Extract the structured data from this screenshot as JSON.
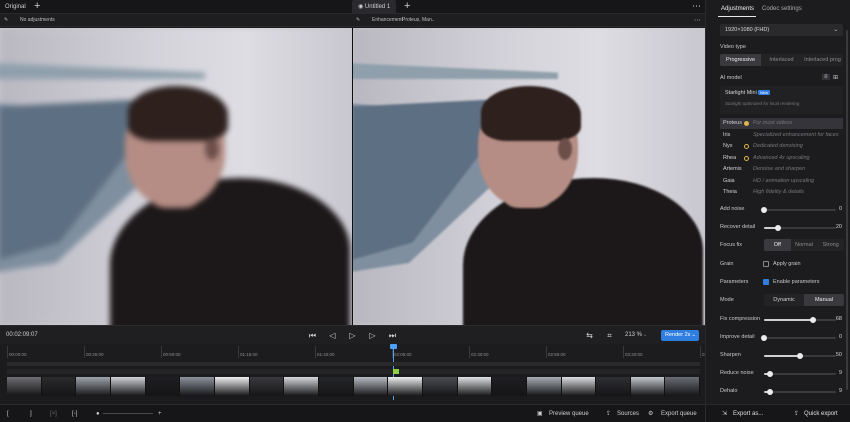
{
  "topbar": {
    "original_tab": "Original",
    "project_tab": "Untitled 1"
  },
  "status": {
    "left_text": "No adjustments",
    "right_label": "Enhancement",
    "right_detail": "Proteus, Man.."
  },
  "transport": {
    "timecode": "00:02:09:07",
    "zoom": "213 %",
    "render_label": "Render 2s"
  },
  "ruler": {
    "ticks": [
      "00:00:00",
      "00:25:00",
      "00:50:00",
      "01:15:00",
      "01:40:00",
      "02:05:00",
      "02:30:00",
      "02:55:00",
      "03:20:00",
      "03:45:00"
    ]
  },
  "filmstrip": {
    "colors": [
      "#6e6e73",
      "#2b2b2e",
      "#9fa4ac",
      "#cfd1d6",
      "#1e1e22",
      "#8d939c",
      "#efeff1",
      "#3a3a3e",
      "#d7d8dc",
      "#25262a",
      "#b8bcc3",
      "#eceef0",
      "#4b4c52",
      "#e0e1e4",
      "#1f1f23",
      "#a8adb4",
      "#dcdde0",
      "#2e2f33",
      "#c4c7cc",
      "#6a6d74"
    ]
  },
  "bottombar": {
    "preview_queue": "Preview queue",
    "sources": "Sources",
    "export_queue": "Export queue"
  },
  "panel": {
    "tab_adjustments": "Adjustments",
    "tab_codec": "Codec settings",
    "resolution": "1920×1080 (FHD)",
    "video_type_label": "Video type",
    "video_types": [
      "Progressive",
      "Interlaced",
      "Interlaced prog"
    ],
    "ai_model_label": "AI model",
    "starlight_name": "Starlight Mini",
    "starlight_badge": "New",
    "starlight_desc": "Starlight optimized for local rendering",
    "models": [
      {
        "name": "Proteus",
        "desc": "For most videos"
      },
      {
        "name": "Iris",
        "desc": "Specialized enhancement for faces"
      },
      {
        "name": "Nyx",
        "desc": "Dedicated denoising"
      },
      {
        "name": "Rhea",
        "desc": "Advanced 4x upscaling"
      },
      {
        "name": "Artemis",
        "desc": "Denoise and sharpen"
      },
      {
        "name": "Gaia",
        "desc": "HD / animation upscaling"
      },
      {
        "name": "Theia",
        "desc": "High fidelity & details"
      }
    ],
    "add_noise": {
      "label": "Add noise",
      "value": "0",
      "level": 0
    },
    "recover_detail": {
      "label": "Recover detail",
      "value": "20",
      "level": 0.2
    },
    "focus_fix_label": "Focus fix",
    "focus_options": [
      "Off",
      "Normal",
      "Strong"
    ],
    "grain_label": "Grain",
    "apply_grain": "Apply grain",
    "parameters_label": "Parameters",
    "enable_parameters": "Enable parameters",
    "mode_label": "Mode",
    "mode_options": [
      "Dynamic",
      "Manual"
    ],
    "fix_compression": {
      "label": "Fix compression",
      "value": "68",
      "level": 0.68
    },
    "improve_detail": {
      "label": "Improve detail",
      "value": "0",
      "level": 0
    },
    "sharpen": {
      "label": "Sharpen",
      "value": "50",
      "level": 0.5
    },
    "reduce_noise": {
      "label": "Reduce noise",
      "value": "9",
      "level": 0.09
    },
    "dehalo": {
      "label": "Dehalo",
      "value": "9",
      "level": 0.09
    },
    "export_as": "Export as...",
    "quick_export": "Quick export"
  }
}
